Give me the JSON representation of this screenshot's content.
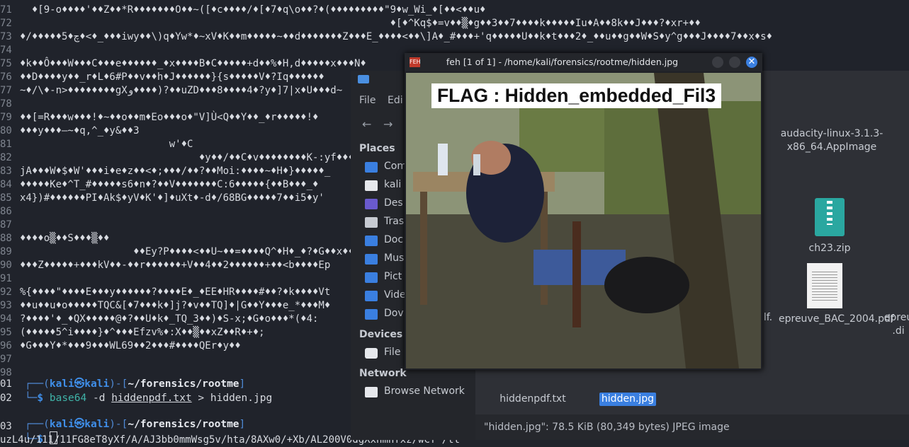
{
  "terminal": {
    "noise_lines": [
      {
        "n": "71",
        "t": "  ♦[9-o♦♦♦♦'♦♦Z♦♦*R♦♦♦♦♦♦♦O♦♦~([♦c♦♦♦♦/♦[♦7♦q\\o♦♦?♦(♦♦♦♦♦♦♦♦♦\"9♦w_Wi_♦[♦♦<♦♦u♦"
      },
      {
        "n": "72",
        "t": "                                                              ♦[♦^Kq$♦=v♦♦▒♦g♦♦3♦♦7♦♦♦♦k♦♦♦♦♦Iu♦A♦♦8k♦♦J♦♦♦?♦xr+♦♦"
      },
      {
        "n": "73",
        "t": "♦/♦♦♦♦♦5♦چ♦<♦_♦♦♦iwy♦♦\\)q♦Yw*♦~xV♦K♦♦m♦♦♦♦♦~♦♦d♦♦♦♦♦♦♦Z♦♦♦E_♦♦♦♦<♦♦\\]A♦_#♦♦♦+'q♦♦♦♦♦U♦♦k♦t♦♦♦2♦_♦♦u♦♦g♦♦W♦S♦y^g♦♦♦J♦♦♦♦7♦♦x♦s♦"
      },
      {
        "n": "74",
        "t": ""
      },
      {
        "n": "75",
        "t": "♦k♦♦Ô♦♦♦W♦♦♦C♦♦♦e♦♦♦♦♦♦_♦x♦♦♦♦B♦C♦♦♦♦♦+d♦♦%♦H,d♦♦♦♦♦x♦♦♦N♦"
      },
      {
        "n": "76",
        "t": "♦♦D♦♦♦♦y♦♦_r♦L♦6#P♦♦v♦♦h♦J♦♦♦♦♦♦}{s♦♦♦♦♦V♦?Iq♦♦♦♦♦♦"
      },
      {
        "n": "77",
        "t": "~♦/\\♦-n>♦♦♦♦♦♦♦♦gXو♦♦♦♦)?♦♦uZD♦♦♦8♦♦♦♦4♦?y♦]7|x♦U♦♦♦d~"
      },
      {
        "n": "78",
        "t": ""
      },
      {
        "n": "79",
        "t": "♦♦[=R♦♦♦w♦♦♦!♦~♦♦o♦♦m♦Eo♦♦♦o♦\"V]Ù<Q♦♦Y♦♦_♦r♦♦♦♦♦!♦"
      },
      {
        "n": "80",
        "t": "♦♦♦y♦♦♦—~♦q,^_♦y&♦♦3"
      },
      {
        "n": "81",
        "t": "                         w'♦C"
      },
      {
        "n": "82",
        "t": "                              ♦y♦♦/♦♦C♦v♦♦♦♦♦♦♦♦K-:yf♦♦♦♦{"
      },
      {
        "n": "83",
        "t": "jA♦♦♦W♦$♦W'♦♦♦i♦e♦z♦♦<♦;♦♦♦/♦♦?♦♦Moi:♦♦♦♦~♦H♦}♦♦♦♦♦_"
      },
      {
        "n": "84",
        "t": "♦♦♦♦♦Ke♦^T_#♦♦♦♦♦s6♦n♦?♦♦V♦♦♦♦♦♦♦C:6♦♦♦♦♦{♦♦B♦♦♦_♦"
      },
      {
        "n": "85",
        "t": "x4})#♦♦♦♦♦♦PI♦Ak$♦yV♦K'♦]♦uXt♦-d♦/68BG♦♦♦♦♦7♦♦i5♦y'"
      },
      {
        "n": "86",
        "t": ""
      },
      {
        "n": "87",
        "t": ""
      },
      {
        "n": "88",
        "t": "♦♦♦♦o▒♦♦S♦♦♦▒♦♦"
      },
      {
        "n": "89",
        "t": "                   ♦♦Ey?P♦♦♦♦<♦♦U~♦♦=♦♦♦♦Q^♦H♦_♦?♦G♦♦x♦♦Q"
      },
      {
        "n": "90",
        "t": "♦♦♦Z♦♦♦♦♦+♦♦♦kV♦♦-♦♦r♦♦♦♦♦♦+V♦♦4♦♦2♦♦♦♦♦♦+♦♦<b♦♦♦♦Ep"
      },
      {
        "n": "91",
        "t": ""
      },
      {
        "n": "92",
        "t": "%{♦♦♦♦\"♦♦♦♦E♦♦♦y♦♦♦♦♦♦?♦♦♦♦E♦_♦EE♦HR♦♦♦♦#♦♦?♦k♦♦♦♦Vt"
      },
      {
        "n": "93",
        "t": "♦♦u♦♦u♦o♦♦♦♦♦TQC&[♦7♦♦♦k♦]j?♦v♦♦TQ]♦|G♦♦Y♦♦♦e_*♦♦♦M♦"
      },
      {
        "n": "94",
        "t": "?♦♦♦♦'♦_♦QX♦♦♦♦♦@♦?♦♦U♦k♦_TQ_3♦♦)♦S-x;♦G♦o♦♦♦*(♦4:"
      },
      {
        "n": "95",
        "t": "(♦♦♦♦♦5^i♦♦♦♦}♦^♦♦♦Efzv%♦:X♦♦▒♦♦xZ♦♦R♦+♦;"
      },
      {
        "n": "96",
        "t": "♦G♦♦♦Y♦*♦♦♦9♦♦♦WL69♦♦2♦♦♦#♦♦♦♦QEr♦y♦♦"
      },
      {
        "n": "97",
        "t": ""
      },
      {
        "n": "98",
        "t": ""
      }
    ],
    "prompt1": {
      "open": "┌──(",
      "user": "kali㉿kali",
      "mid": ")-[",
      "path": "~/forensics/rootme",
      "close": "]"
    },
    "command": {
      "corner": "└─",
      "dollar": "$ ",
      "cmd": "base64",
      "flag": "-d",
      "infile": "hiddenpdf.txt",
      "redir": ">",
      "outfile": "hidden.jpg"
    },
    "prompt2": {
      "open": "┌──(",
      "user": "kali㉿kali",
      "mid": ")-[",
      "path": "~/forensics/rootme",
      "close": "]"
    },
    "prompt2_cmd": {
      "corner": "└─",
      "dollar": "$ "
    },
    "bottom_lines": [
      "01",
      "02",
      "03"
    ],
    "last_line": "uzL4u/111/11FG8eT8yXf/A/AJ3bb0mmWsg5v/hta/8AXw0/+Xb/AL200V0dgXxhmnfxz/wCf /tt"
  },
  "filemgr": {
    "menu": [
      "File",
      "Edi"
    ],
    "places_heading": "Places",
    "places": [
      {
        "label": "Com",
        "color": "#3a7fe0"
      },
      {
        "label": "kali",
        "color": "#e6e8ec"
      },
      {
        "label": "Des",
        "color": "#6a5acd"
      },
      {
        "label": "Tras",
        "color": "#c7cbd2"
      },
      {
        "label": "Doc",
        "color": "#3a7fe0"
      },
      {
        "label": "Mus",
        "color": "#3a7fe0"
      },
      {
        "label": "Pict",
        "color": "#3a7fe0"
      },
      {
        "label": "Vide",
        "color": "#3a7fe0"
      },
      {
        "label": "Dov",
        "color": "#3a7fe0"
      }
    ],
    "devices_heading": "Devices",
    "devices": [
      {
        "label": "File"
      }
    ],
    "network_heading": "Network",
    "network": [
      {
        "label": "Browse Network"
      }
    ],
    "files": [
      {
        "name": "audacity-linux-3.1.3-x86_64.AppImage"
      },
      {
        "name": "ch23.zip"
      },
      {
        "name": "lf."
      },
      {
        "name": "epreuve_BAC_2004.pdf"
      },
      {
        "name": "epreu .di"
      },
      {
        "name": "hiddenpdf.txt"
      },
      {
        "name": "hidden.jpg"
      }
    ],
    "status": "\"hidden.jpg\": 78.5 KiB (80,349 bytes) JPEG image"
  },
  "feh": {
    "app_icon": "FEH",
    "title": "feh [1 of 1] - /home/kali/forensics/rootme/hidden.jpg",
    "flag_text": "FLAG : Hidden_embedded_Fil3"
  }
}
